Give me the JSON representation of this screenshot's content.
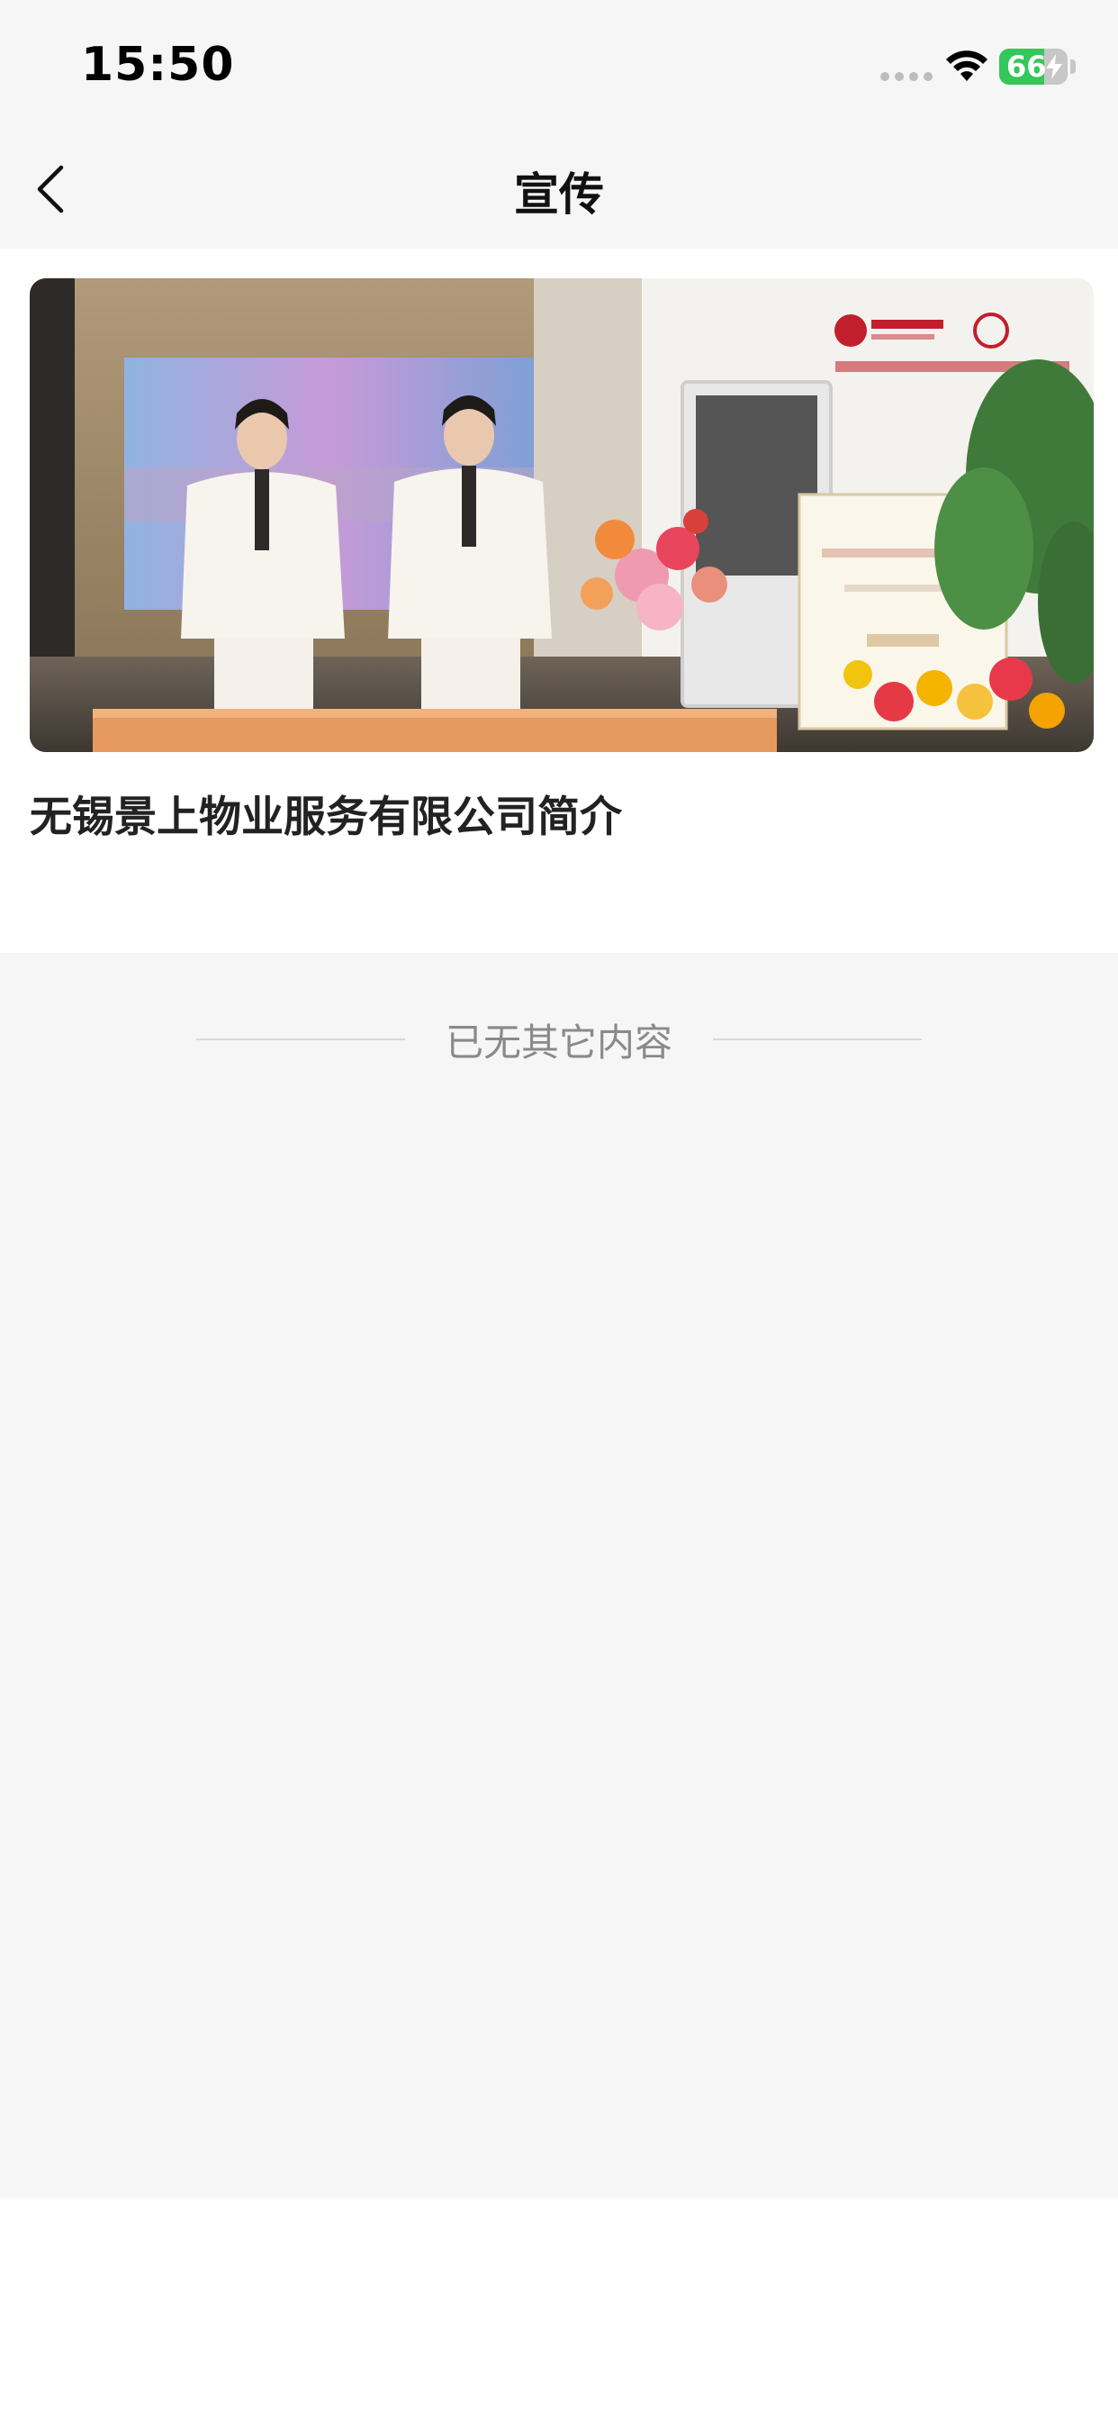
{
  "status_bar": {
    "time": "15:50",
    "battery_level": "66",
    "battery_fraction": 0.66
  },
  "nav": {
    "title": "宣传",
    "back_icon": "chevron-left-icon"
  },
  "articles": [
    {
      "title": "无锡景上物业服务有限公司简介",
      "image_desc_icon": "photo"
    }
  ],
  "footer": {
    "end_text": "已无其它内容"
  },
  "colors": {
    "battery_green": "#34c759",
    "background": "#f6f6f6",
    "card": "#ffffff"
  }
}
